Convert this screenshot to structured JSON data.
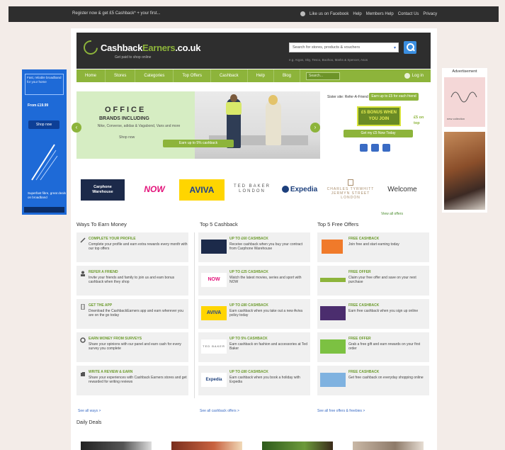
{
  "topbar": {
    "message": "Register now & get £5 Cashback* + your first...",
    "links": [
      "Like us on Facebook",
      "Help",
      "Members Help",
      "Contact Us",
      "Privacy"
    ]
  },
  "header": {
    "logo_main": "Cashback",
    "logo_green": "Earners",
    "logo_suffix": ".co.uk",
    "tagline": "Get paid to shop online",
    "search_placeholder": "Search for stores, products & vouchers",
    "search_hints": "e.g. Argos, Sky, Tesco, Boohoo, Marks & Spencer, Asos"
  },
  "nav": {
    "items": [
      "Home",
      "Stores",
      "Categories",
      "Top Offers",
      "Cashback",
      "Help",
      "Blog"
    ],
    "search_box": "Search...",
    "login": "Log in"
  },
  "hero": {
    "title": "OFFICE",
    "subtitle": "BRANDS INCLUDING",
    "desc": "Nike, Converse, adidas & Vagabond, Vans and more",
    "small": "Shop now",
    "cta": "Earn up to 5% cashback"
  },
  "promo": {
    "label": "Sister site: Refer-A-Friend",
    "tab": "Earn up to £5 for each friend",
    "badge_line1": "£5 BONUS WHEN",
    "badge_line2": "YOU JOIN",
    "side": "£5 on top",
    "button": "Get my £5 Now Today"
  },
  "brands": {
    "cw_line1": "Carphone",
    "cw_line2": "Warehouse",
    "now": "NOW",
    "aviva": "AVIVA",
    "tb_line1": "TED BAKER",
    "tb_line2": "LONDON",
    "expedia": "Expedia",
    "cl_line1": "CHARLES TYRWHITT",
    "cl_line2": "JERMYN STREET LONDON",
    "welcome": "Welcome"
  },
  "sections": {
    "view_all": "View all offers",
    "earn_title": "Ways To Earn Money",
    "cashback_title": "Top 5 Cashback",
    "offers_title": "Top 5 Free Offers",
    "daily_title": "Daily Deals",
    "more_earn": "See all ways >",
    "more_cashback": "See all cashback offers >",
    "more_offers": "See all free offers & freebies >"
  },
  "earn": [
    {
      "title": "COMPLETE YOUR PROFILE",
      "desc": "Complete your profile and earn extra rewards every month with our top offers"
    },
    {
      "title": "REFER A FRIEND",
      "desc": "Invite your friends and family to join us and earn bonus cashback when they shop"
    },
    {
      "title": "GET THE APP",
      "desc": "Download the CashbackEarners app and earn wherever you are on the go today"
    },
    {
      "title": "EARN MONEY FROM SURVEYS",
      "desc": "Share your opinions with our panel and earn cash for every survey you complete"
    },
    {
      "title": "WRITE A REVIEW & EARN",
      "desc": "Share your experiences with Cashback Earners stores and get rewarded for writing reviews"
    }
  ],
  "cashback": [
    {
      "title": "UP TO £60 CASHBACK",
      "desc": "Receive cashback when you buy your contract from Carphone Warehouse"
    },
    {
      "title": "UP TO £25 CASHBACK",
      "desc": "Watch the latest movies, series and sport with NOW"
    },
    {
      "title": "UP TO £80 CASHBACK",
      "desc": "Earn cashback when you take out a new Aviva policy today"
    },
    {
      "title": "UP TO 5% CASHBACK",
      "desc": "Earn cashback on fashion and accessories at Ted Baker"
    },
    {
      "title": "UP TO £80 CASHBACK",
      "desc": "Earn cashback when you book a holiday with Expedia"
    }
  ],
  "offers": [
    {
      "title": "FREE CASHBACK",
      "desc": "Join free and start earning today"
    },
    {
      "title": "FREE OFFER",
      "desc": "Claim your free offer and save on your next purchase"
    },
    {
      "title": "FREE CASHBACK",
      "desc": "Earn free cashback when you sign up online"
    },
    {
      "title": "FREE OFFER",
      "desc": "Grab a free gift and earn rewards on your first order"
    },
    {
      "title": "FREE CASHBACK",
      "desc": "Get free cashback on everyday shopping online"
    }
  ],
  "ads": {
    "left_top": "Fast, reliable broadband for your home",
    "left_price": "From £19.99",
    "left_button": "Shop now",
    "left_bottom": "Superfast fibre, great deals on broadband",
    "right_title": "Advertisement",
    "right_cap": "new collection"
  },
  "colors": {
    "accent": "#8db43b",
    "dark": "#2e2e2e",
    "link": "#3a6bc4"
  }
}
